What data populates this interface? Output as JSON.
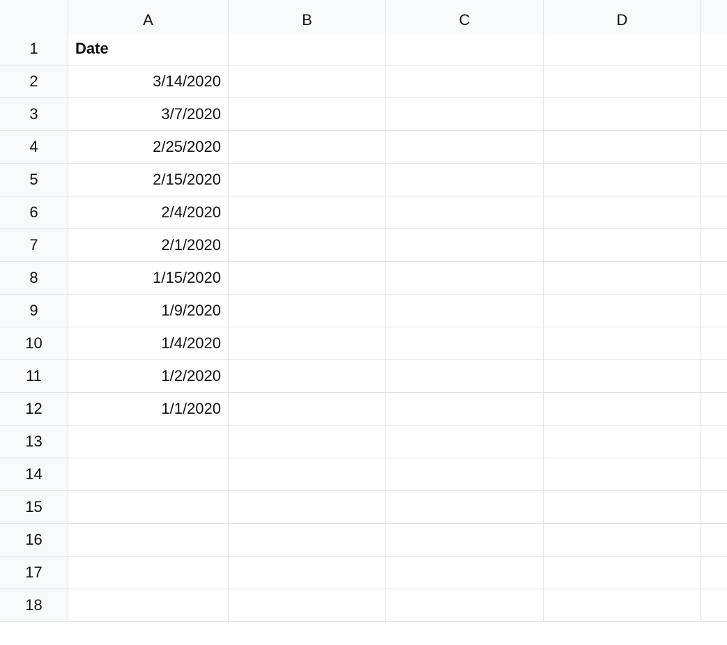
{
  "columns": [
    "A",
    "B",
    "C",
    "D",
    ""
  ],
  "rowCount": 18,
  "cells": {
    "A1": {
      "value": "Date",
      "bold": true,
      "align": "left"
    },
    "A2": {
      "value": "3/14/2020",
      "align": "right"
    },
    "A3": {
      "value": "3/7/2020",
      "align": "right"
    },
    "A4": {
      "value": "2/25/2020",
      "align": "right"
    },
    "A5": {
      "value": "2/15/2020",
      "align": "right"
    },
    "A6": {
      "value": "2/4/2020",
      "align": "right"
    },
    "A7": {
      "value": "2/1/2020",
      "align": "right"
    },
    "A8": {
      "value": "1/15/2020",
      "align": "right"
    },
    "A9": {
      "value": "1/9/2020",
      "align": "right"
    },
    "A10": {
      "value": "1/4/2020",
      "align": "right"
    },
    "A11": {
      "value": "1/2/2020",
      "align": "right"
    },
    "A12": {
      "value": "1/1/2020",
      "align": "right"
    }
  }
}
